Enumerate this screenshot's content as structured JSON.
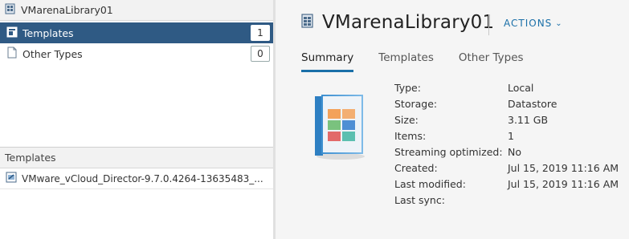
{
  "left": {
    "header_title": "VMarenaLibrary01",
    "tree": [
      {
        "label": "Templates",
        "count": "1",
        "selected": true
      },
      {
        "label": "Other Types",
        "count": "0",
        "selected": false
      }
    ],
    "templates_panel": {
      "title": "Templates",
      "items": [
        "VMware_vCloud_Director-9.7.0.4264-13635483_..."
      ]
    }
  },
  "main": {
    "title": "VMarenaLibrary01",
    "actions_label": "ACTIONS",
    "tabs": [
      {
        "label": "Summary",
        "active": true
      },
      {
        "label": "Templates",
        "active": false
      },
      {
        "label": "Other Types",
        "active": false
      }
    ],
    "properties": [
      {
        "key": "Type:",
        "value": "Local"
      },
      {
        "key": "Storage:",
        "value": "Datastore"
      },
      {
        "key": "Size:",
        "value": "3.11 GB"
      },
      {
        "key": "Items:",
        "value": "1"
      },
      {
        "key": "Streaming optimized:",
        "value": "No"
      },
      {
        "key": "Created:",
        "value": "Jul 15, 2019 11:16 AM"
      },
      {
        "key": "Last modified:",
        "value": "Jul 15, 2019 11:16 AM"
      },
      {
        "key": "Last sync:",
        "value": ""
      }
    ]
  },
  "colors": {
    "selection": "#2f5a84",
    "accent": "#1a6fa8"
  },
  "icons": {
    "library": "library-icon",
    "templates": "templates-icon",
    "other_types": "document-icon",
    "vapp_template": "vapp-template-icon",
    "library_book": "content-library-book-icon"
  }
}
